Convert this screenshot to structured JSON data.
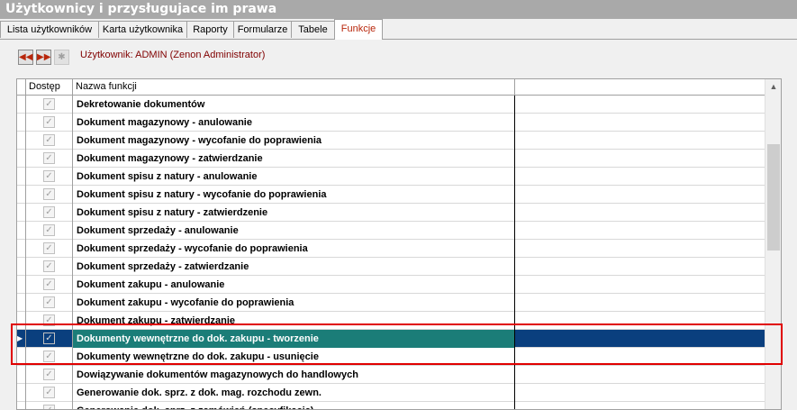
{
  "window": {
    "title": "Użytkownicy i przysługujace im prawa"
  },
  "tabs": [
    {
      "label": "Lista użytkowników"
    },
    {
      "label": "Karta użytkownika"
    },
    {
      "label": "Raporty"
    },
    {
      "label": "Formularze"
    },
    {
      "label": "Tabele"
    },
    {
      "label": "Funkcje"
    }
  ],
  "active_tab": "Funkcje",
  "toolbar": {
    "first_icon": "double-left-arrow",
    "next_icon": "double-right-arrow",
    "disabled_icon": "gear",
    "user_label": "Użytkownik: ADMIN  (Zenon Administrator)"
  },
  "grid": {
    "columns": [
      "Dostęp",
      "Nazwa funkcji"
    ],
    "rows": [
      {
        "checked": true,
        "name": "Dekretowanie dokumentów"
      },
      {
        "checked": true,
        "name": "Dokument magazynowy - anulowanie"
      },
      {
        "checked": true,
        "name": "Dokument magazynowy - wycofanie do poprawienia"
      },
      {
        "checked": true,
        "name": "Dokument magazynowy - zatwierdzanie"
      },
      {
        "checked": true,
        "name": "Dokument spisu z natury - anulowanie"
      },
      {
        "checked": true,
        "name": "Dokument spisu z natury - wycofanie do poprawienia"
      },
      {
        "checked": true,
        "name": "Dokument spisu z natury - zatwierdzenie"
      },
      {
        "checked": true,
        "name": "Dokument sprzedaży - anulowanie"
      },
      {
        "checked": true,
        "name": "Dokument sprzedaży - wycofanie do poprawienia"
      },
      {
        "checked": true,
        "name": "Dokument sprzedaży - zatwierdzanie"
      },
      {
        "checked": true,
        "name": "Dokument zakupu - anulowanie"
      },
      {
        "checked": true,
        "name": "Dokument zakupu - wycofanie do poprawienia"
      },
      {
        "checked": true,
        "name": "Dokument zakupu - zatwierdzanie"
      },
      {
        "checked": true,
        "name": "Dokumenty wewnętrzne do dok. zakupu - tworzenie",
        "selected": true
      },
      {
        "checked": true,
        "name": "Dokumenty wewnętrzne do dok. zakupu - usunięcie"
      },
      {
        "checked": true,
        "name": "Dowiązywanie dokumentów magazynowych do handlowych"
      },
      {
        "checked": true,
        "name": "Generowanie dok. sprz. z dok. mag. rozchodu zewn."
      },
      {
        "checked": true,
        "name": "Generowanie dok. sprz. z zamówień (specyfikacja)"
      }
    ]
  },
  "colors": {
    "title_bg": "#a9a9a9",
    "active_tab_text": "#b8260b",
    "selected_row": "#0a3f7e",
    "selected_name_cell": "#1b7d78",
    "highlight_border": "#e00000"
  }
}
